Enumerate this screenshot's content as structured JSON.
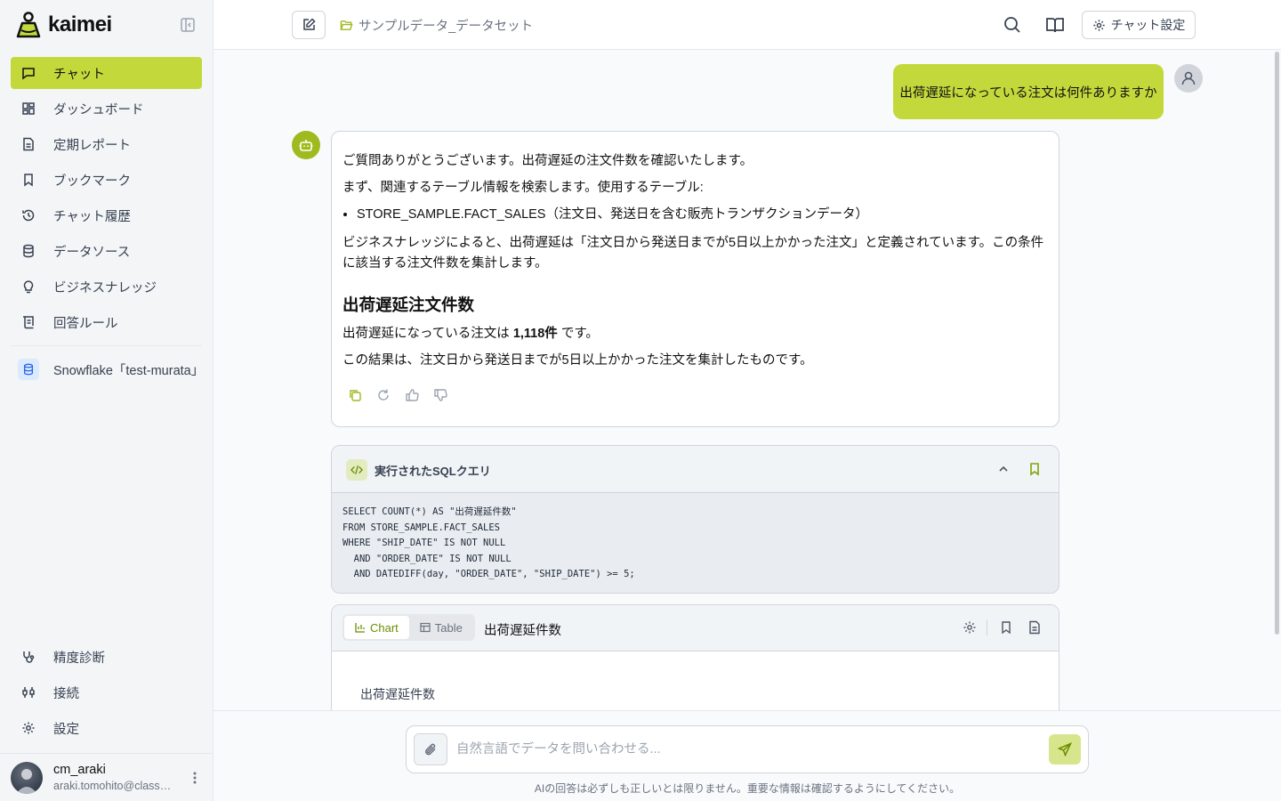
{
  "app": {
    "name": "kaimei"
  },
  "sidebar": {
    "items": [
      {
        "label": "チャット",
        "icon": "chat-icon",
        "active": true
      },
      {
        "label": "ダッシュボード",
        "icon": "dashboard-icon"
      },
      {
        "label": "定期レポート",
        "icon": "report-icon"
      },
      {
        "label": "ブックマーク",
        "icon": "bookmark-icon"
      },
      {
        "label": "チャット履歴",
        "icon": "history-icon"
      },
      {
        "label": "データソース",
        "icon": "database-icon"
      },
      {
        "label": "ビジネスナレッジ",
        "icon": "lightbulb-icon"
      },
      {
        "label": "回答ルール",
        "icon": "scroll-icon"
      }
    ],
    "connection": "Snowflake「test-murata」",
    "bottom_items": [
      {
        "label": "精度診断",
        "icon": "stethoscope-icon"
      },
      {
        "label": "接続",
        "icon": "plug-icon"
      },
      {
        "label": "設定",
        "icon": "gear-icon"
      }
    ],
    "user": {
      "name": "cm_araki",
      "email": "araki.tomohito@classmethod.jp"
    }
  },
  "header": {
    "dataset": "サンプルデータ_データセット",
    "settings_label": "チャット設定"
  },
  "conversation": {
    "user_message": "出荷遅延になっている注文は何件ありますか",
    "bot": {
      "intro": "ご質問ありがとうございます。出荷遅延の注文件数を確認いたします。",
      "search_text": "まず、関連するテーブル情報を検索します。使用するテーブル:",
      "table_item": "STORE_SAMPLE.FACT_SALES（注文日、発送日を含む販売トランザクションデータ）",
      "knowledge_text": "ビジネスナレッジによると、出荷遅延は「注文日から発送日までが5日以上かかった注文」と定義されています。この条件に該当する注文件数を集計します。",
      "heading": "出荷遅延注文件数",
      "result_prefix": "出荷遅延になっている注文は ",
      "result_value": "1,118件",
      "result_suffix": " です。",
      "summary": "この結果は、注文日から発送日までが5日以上かかった注文を集計したものです。"
    },
    "sql": {
      "title": "実行されたSQLクエリ",
      "code": "SELECT COUNT(*) AS \"出荷遅延件数\"\nFROM STORE_SAMPLE.FACT_SALES\nWHERE \"SHIP_DATE\" IS NOT NULL\n  AND \"ORDER_DATE\" IS NOT NULL\n  AND DATEDIFF(day, \"ORDER_DATE\", \"SHIP_DATE\") >= 5;"
    },
    "result": {
      "tab_chart": "Chart",
      "tab_table": "Table",
      "active_tab": "Chart",
      "title": "出荷遅延件数",
      "chart_title": "出荷遅延件数"
    }
  },
  "composer": {
    "placeholder": "自然言語でデータを問い合わせる...",
    "disclaimer": "AIの回答は必ずしも正しいとは限りません。重要な情報は確認するようにしてください。"
  },
  "colors": {
    "accent": "#c3d93b",
    "accent_dark": "#6b8e00"
  }
}
